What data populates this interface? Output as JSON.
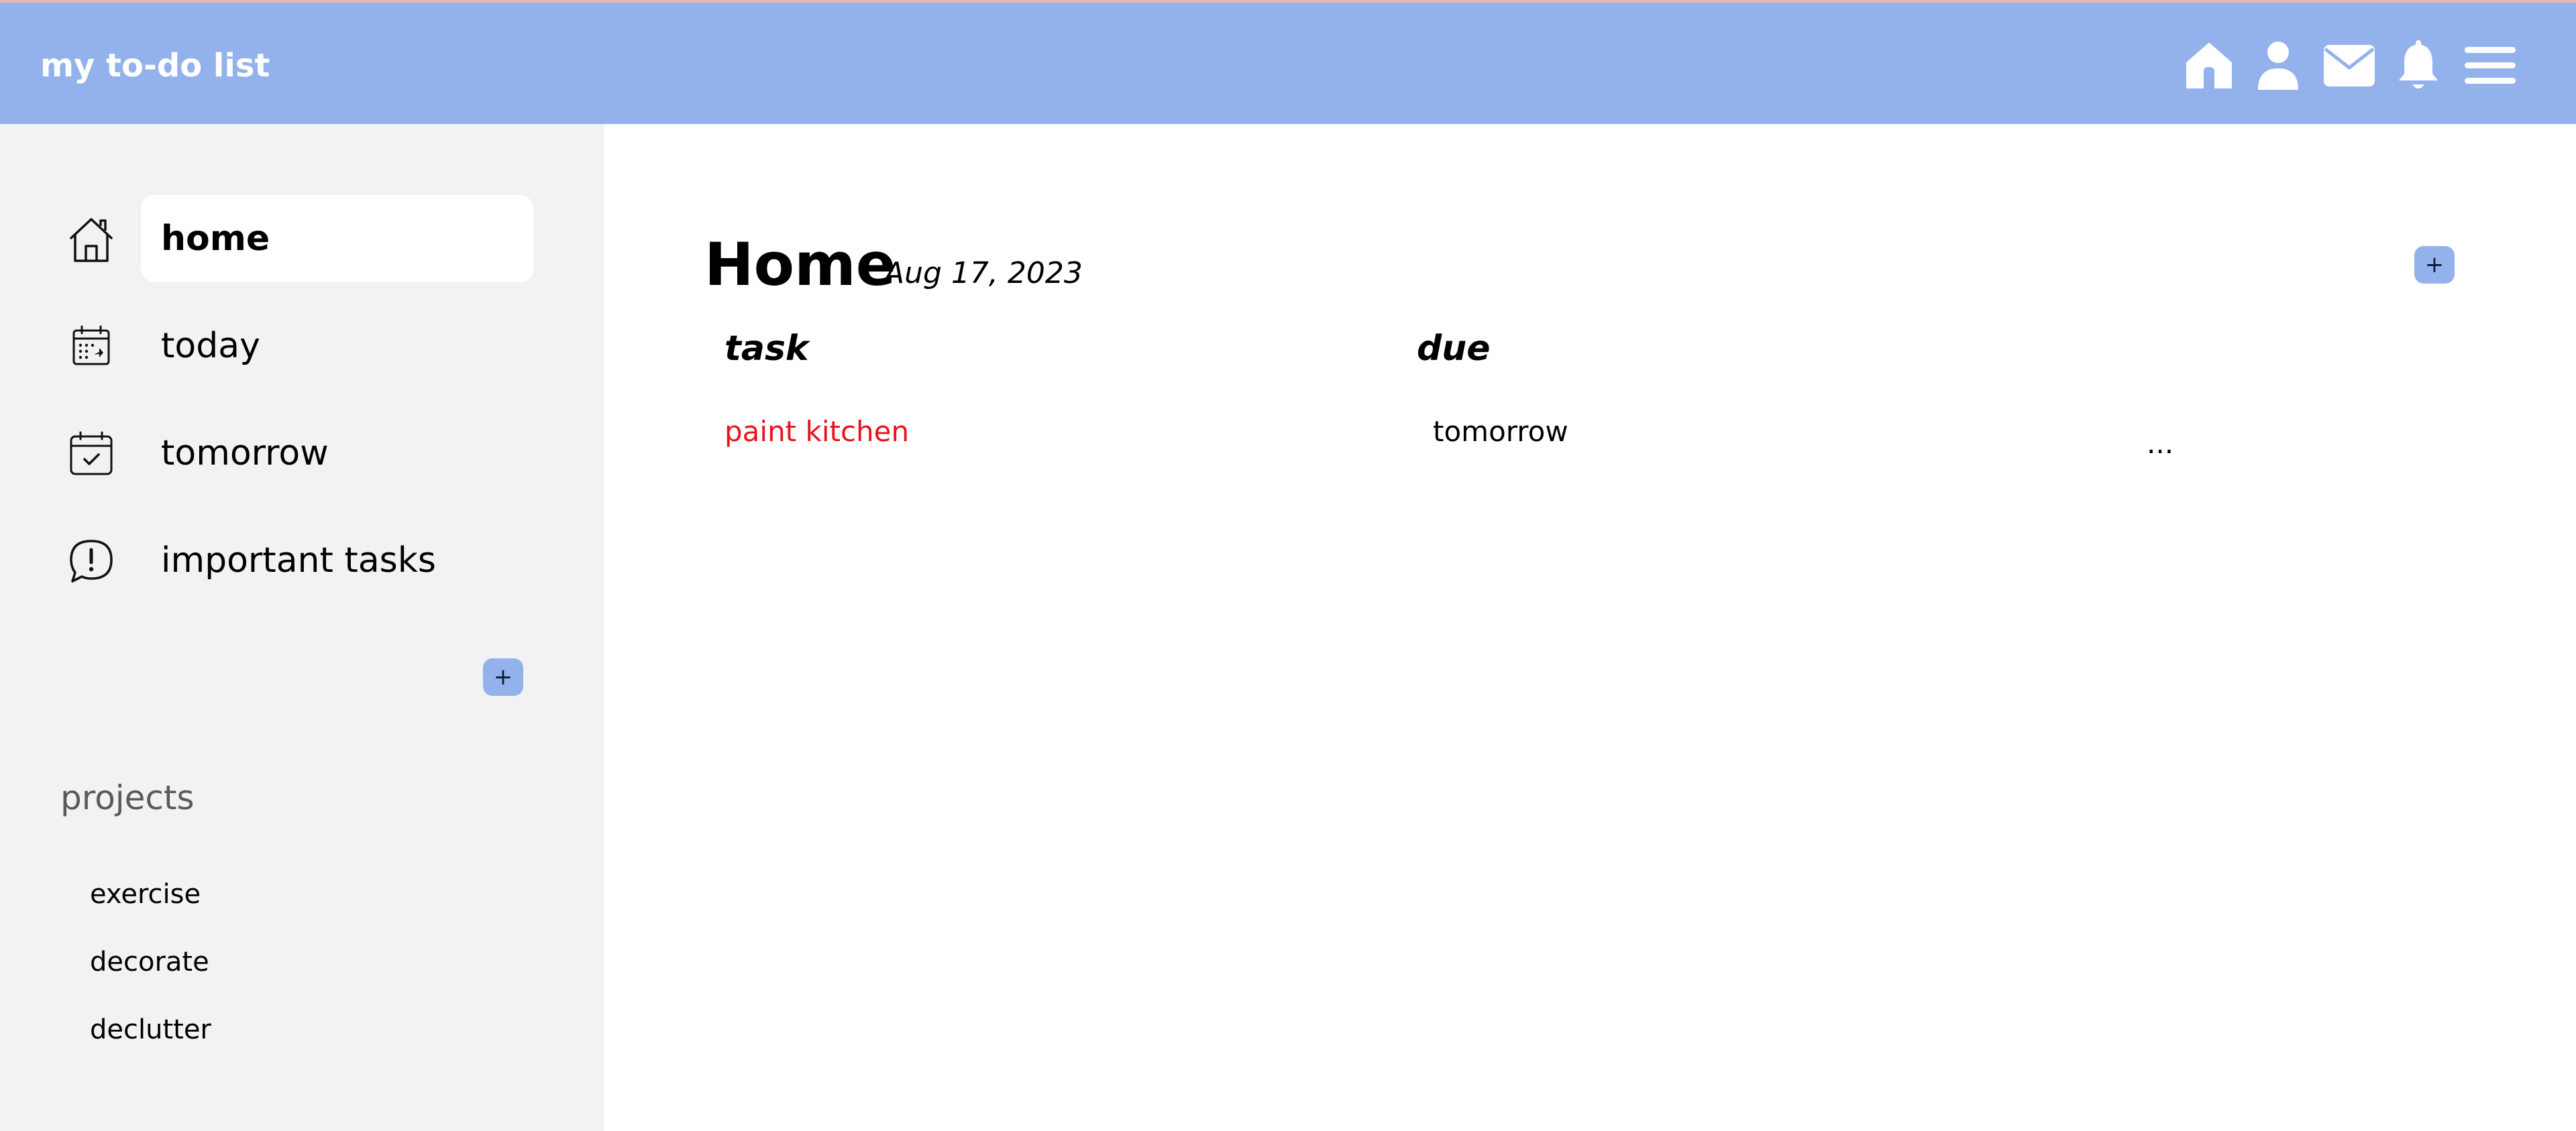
{
  "header": {
    "title": "my to-do list",
    "icons": [
      "home-icon",
      "user-icon",
      "mail-icon",
      "bell-icon",
      "menu-icon"
    ]
  },
  "sidebar": {
    "items": [
      {
        "label": "home",
        "icon": "home-icon",
        "active": true
      },
      {
        "label": "today",
        "icon": "calendar-grid-icon",
        "active": false
      },
      {
        "label": "tomorrow",
        "icon": "calendar-check-icon",
        "active": false
      },
      {
        "label": "important tasks",
        "icon": "alert-bubble-icon",
        "active": false
      }
    ],
    "projects": {
      "heading": "projects",
      "add_label": "+",
      "items": [
        "exercise",
        "decorate",
        "declutter"
      ]
    }
  },
  "main": {
    "title": "Home",
    "date": "Aug 17, 2023",
    "add_label": "+",
    "columns": {
      "task": "task",
      "due": "due"
    },
    "rows": [
      {
        "task": "paint kitchen",
        "due": "tomorrow",
        "more": "..."
      }
    ]
  },
  "colors": {
    "header_bg": "#93b2eb",
    "sidebar_bg": "#f1f2f1",
    "accent": "#93b2eb",
    "important_text": "#e8141b"
  }
}
